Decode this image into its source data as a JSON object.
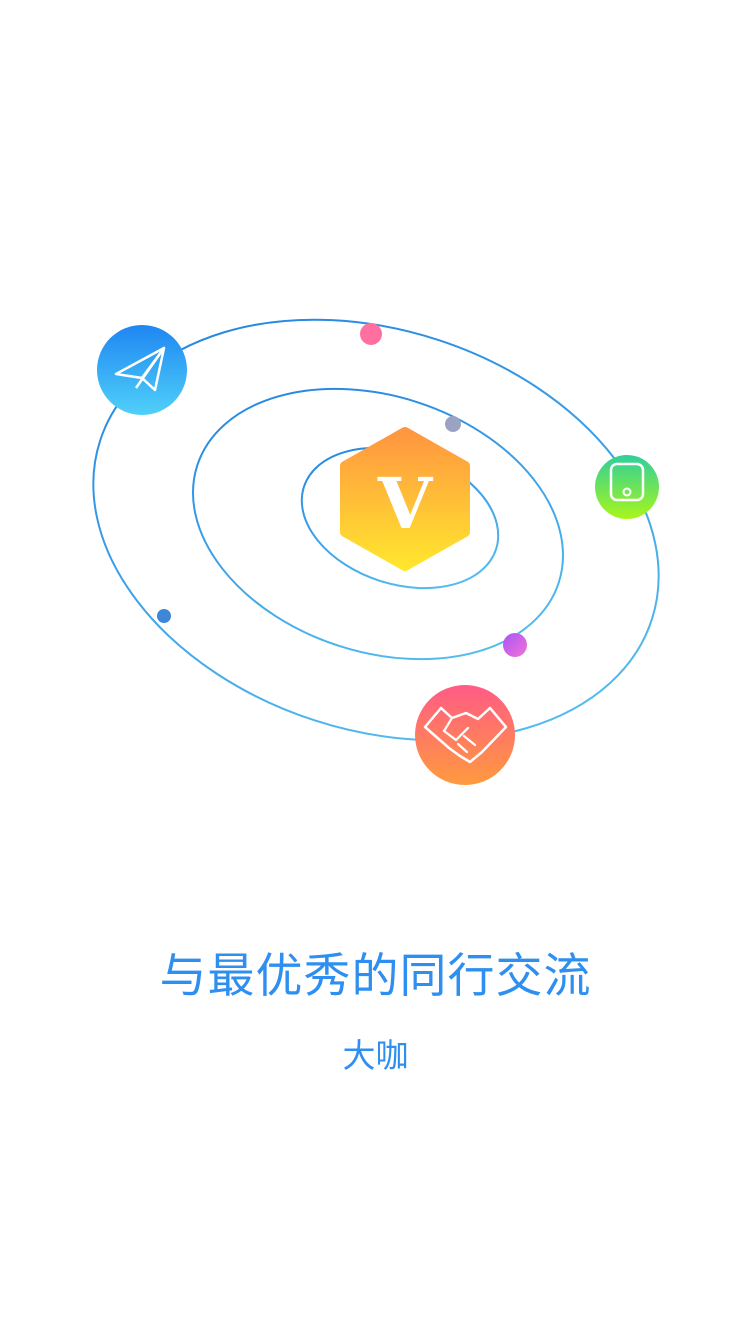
{
  "badge": {
    "letter": "V"
  },
  "headline": "与最优秀的同行交流",
  "subtitle": "大咖",
  "colors": {
    "text": "#2f8ff0",
    "orbit_start": "#1e7fe0",
    "orbit_end": "#5cc6f0"
  },
  "icons": {
    "planet_top_left": "paper-plane-icon",
    "planet_right": "phone-icon",
    "planet_bottom": "handshake-icon",
    "center": "v-badge-icon"
  }
}
